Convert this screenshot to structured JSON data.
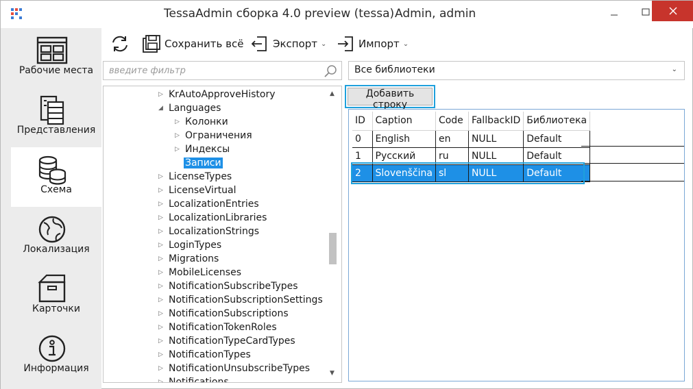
{
  "window": {
    "title": "TessaAdmin сборка 4.0 preview (tessa)",
    "user": "Admin, admin",
    "controls": [
      "minimize",
      "maximize",
      "close"
    ]
  },
  "nav": {
    "items": [
      {
        "label": "Рабочие места",
        "icon": "workplaces-icon"
      },
      {
        "label": "Представления",
        "icon": "views-icon"
      },
      {
        "label": "Схема",
        "icon": "database-icon",
        "active": true
      },
      {
        "label": "Локализация",
        "icon": "globe-icon"
      },
      {
        "label": "Карточки",
        "icon": "box-icon"
      },
      {
        "label": "Информация",
        "icon": "info-icon"
      }
    ]
  },
  "toolbar": {
    "refresh_icon": "refresh-icon",
    "save_label": "Сохранить всё",
    "export_label": "Экспорт",
    "import_label": "Импорт"
  },
  "filter": {
    "placeholder": "введите фильтр"
  },
  "library_select": {
    "value": "Все библиотеки"
  },
  "tree": {
    "rows": [
      {
        "label": "KrAutoApproveHistory",
        "level": 0,
        "state": "collapsed"
      },
      {
        "label": "Languages",
        "level": 0,
        "state": "expanded"
      },
      {
        "label": "Колонки",
        "level": 1,
        "state": "collapsed"
      },
      {
        "label": "Ограничения",
        "level": 1,
        "state": "collapsed"
      },
      {
        "label": "Индексы",
        "level": 1,
        "state": "collapsed"
      },
      {
        "label": "Записи",
        "level": 1,
        "state": "leaf",
        "selected": true
      },
      {
        "label": "LicenseTypes",
        "level": 0,
        "state": "collapsed"
      },
      {
        "label": "LicenseVirtual",
        "level": 0,
        "state": "collapsed"
      },
      {
        "label": "LocalizationEntries",
        "level": 0,
        "state": "collapsed"
      },
      {
        "label": "LocalizationLibraries",
        "level": 0,
        "state": "collapsed"
      },
      {
        "label": "LocalizationStrings",
        "level": 0,
        "state": "collapsed"
      },
      {
        "label": "LoginTypes",
        "level": 0,
        "state": "collapsed"
      },
      {
        "label": "Migrations",
        "level": 0,
        "state": "collapsed"
      },
      {
        "label": "MobileLicenses",
        "level": 0,
        "state": "collapsed"
      },
      {
        "label": "NotificationSubscribeTypes",
        "level": 0,
        "state": "collapsed"
      },
      {
        "label": "NotificationSubscriptionSettings",
        "level": 0,
        "state": "collapsed"
      },
      {
        "label": "NotificationSubscriptions",
        "level": 0,
        "state": "collapsed"
      },
      {
        "label": "NotificationTokenRoles",
        "level": 0,
        "state": "collapsed"
      },
      {
        "label": "NotificationTypeCardTypes",
        "level": 0,
        "state": "collapsed"
      },
      {
        "label": "NotificationTypes",
        "level": 0,
        "state": "collapsed"
      },
      {
        "label": "NotificationUnsubscribeTypes",
        "level": 0,
        "state": "collapsed"
      },
      {
        "label": "Notifications",
        "level": 0,
        "state": "collapsed"
      }
    ]
  },
  "records": {
    "add_button_label": "Добавить строку",
    "columns": [
      "ID",
      "Caption",
      "Code",
      "FallbackID",
      "Библиотека"
    ],
    "rows": [
      [
        "0",
        "English",
        "en",
        "NULL",
        "Default"
      ],
      [
        "1",
        "Русский",
        "ru",
        "NULL",
        "Default"
      ],
      [
        "2",
        "Slovenščina",
        "sl",
        "NULL",
        "Default"
      ]
    ],
    "selected_row": 2
  },
  "colors": {
    "accent": "#1e90e6",
    "highlight": "#1ea0dc",
    "close": "#c7342c",
    "nav_bg": "#ececec"
  }
}
